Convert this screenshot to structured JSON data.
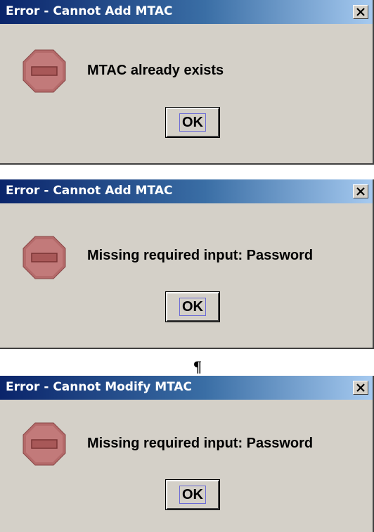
{
  "dialogs": [
    {
      "title": "Error - Cannot Add MTAC",
      "message": "MTAC already exists",
      "ok_label": "OK"
    },
    {
      "title": "Error - Cannot Add MTAC",
      "message": "Missing required input: Password",
      "ok_label": "OK"
    },
    {
      "title": "Error - Cannot Modify MTAC",
      "message": "Missing required input: Password",
      "ok_label": "OK"
    }
  ],
  "separator_mark": "¶",
  "icons": {
    "error": "stop-sign-icon",
    "close": "close-icon"
  },
  "colors": {
    "titlebar_start": "#0a246a",
    "titlebar_end": "#a6caf0",
    "dialog_bg": "#d4d0c8",
    "stop_sign": "#b46a6a"
  }
}
